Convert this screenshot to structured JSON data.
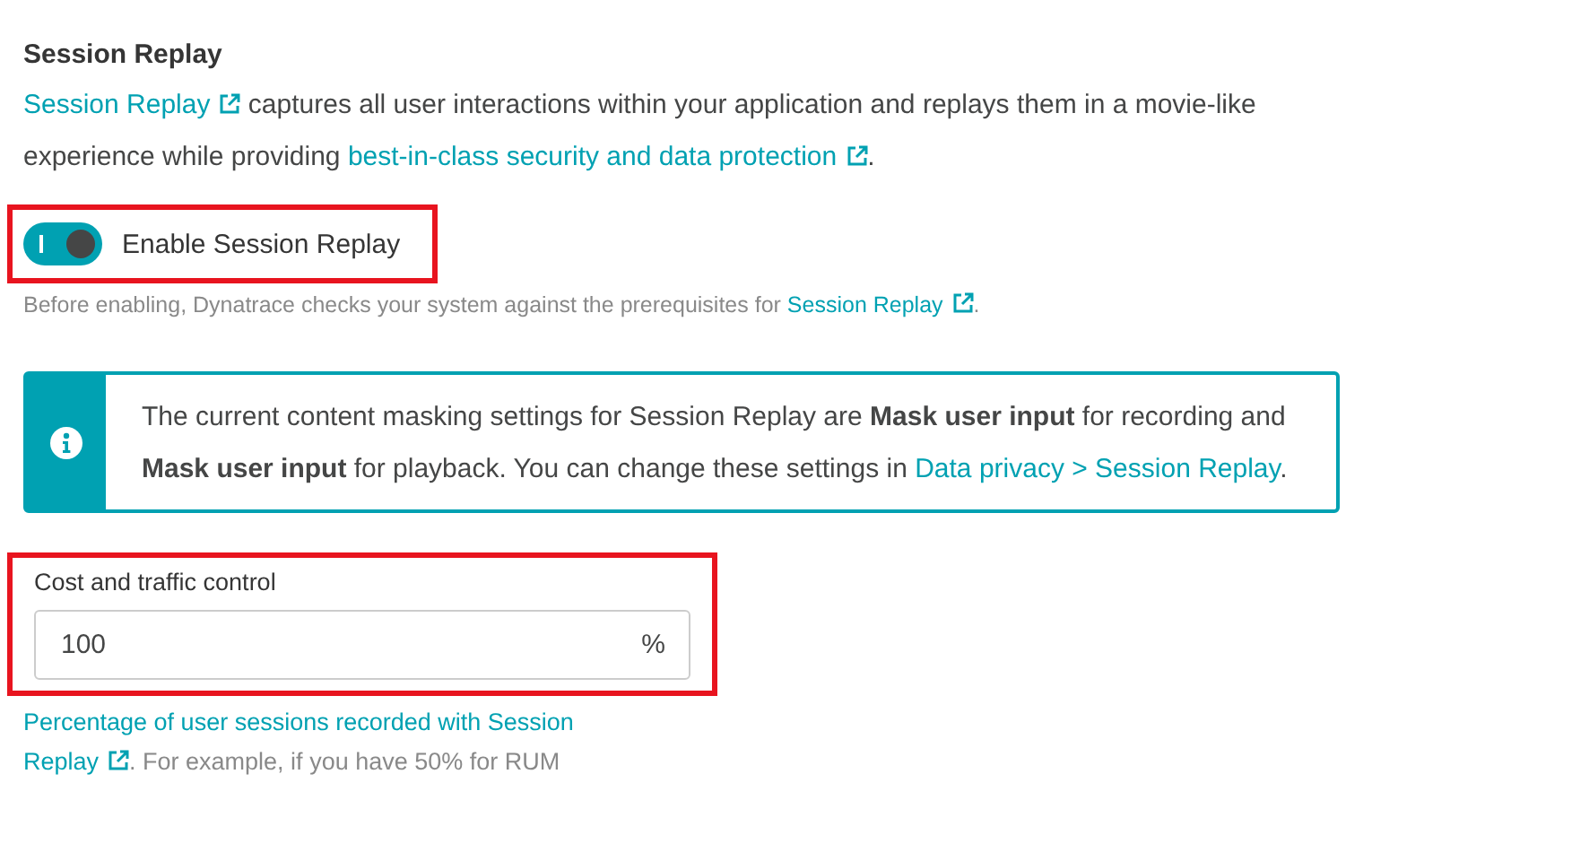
{
  "section": {
    "title": "Session Replay",
    "intro": [
      {
        "kind": "link",
        "text": "Session Replay",
        "external": true
      },
      {
        "kind": "text",
        "text": "captures all user interactions within your application and replays them in a movie-like experience while providing"
      },
      {
        "kind": "link",
        "text": "best-in-class security and data protection",
        "external": true
      },
      {
        "kind": "text",
        "text": "."
      }
    ]
  },
  "toggle": {
    "label": "Enable Session Replay",
    "on": true,
    "highlighted": true
  },
  "hint": [
    {
      "kind": "text",
      "text": "Before enabling, Dynatrace checks your system against the prerequisites for"
    },
    {
      "kind": "link",
      "text": "Session Replay",
      "external": true
    },
    {
      "kind": "text",
      "text": "."
    }
  ],
  "info_box": {
    "segments": [
      {
        "kind": "text",
        "text": "The current content masking settings for Session Replay are **Mask user input** for recording and **Mask user input** for playback. You can change these settings in"
      },
      {
        "kind": "link",
        "text": "Data privacy > Session Replay",
        "external": false
      },
      {
        "kind": "text",
        "text": "."
      }
    ]
  },
  "cost_field": {
    "label": "Cost and traffic control",
    "value": "100",
    "unit": "%",
    "highlighted": true,
    "help": [
      {
        "kind": "link",
        "text": "Percentage of user sessions recorded with Session",
        "external": false
      },
      {
        "kind": "link",
        "text": "Replay",
        "external": true
      },
      {
        "kind": "text",
        "text": ". For example, if you have 50% for RUM"
      }
    ]
  }
}
